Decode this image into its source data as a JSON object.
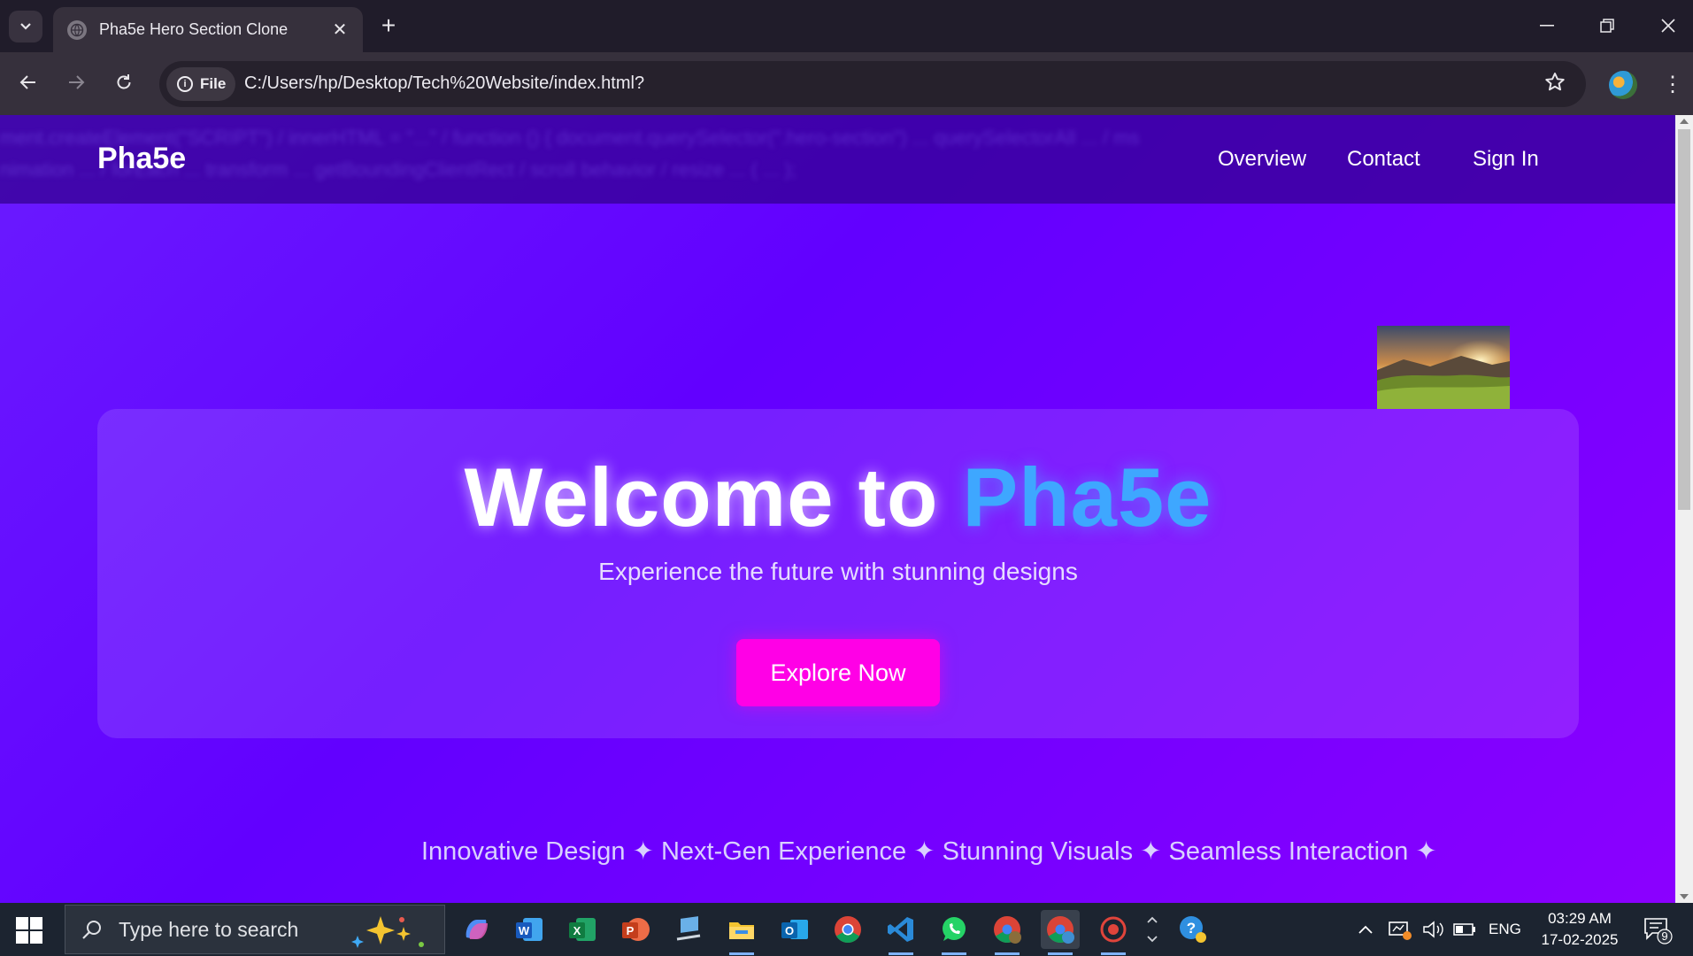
{
  "browser": {
    "tab_title": "Pha5e Hero Section Clone",
    "chip_label": "File",
    "url": "C:/Users/hp/Desktop/Tech%20Website/index.html?"
  },
  "site": {
    "brand": "Pha5e",
    "nav": [
      "Overview",
      "Contact",
      "Sign In"
    ],
    "blurred_background_text": [
      "ment.createElement(\"SCRIPT\") / innerHTML = \"...\" / function () { document.querySelector(\".hero-section\") ... querySelectorAll ... / ms",
      "nimation ... / forEach ... transform ... getBoundingClientRect / scroll behavior / resize ... ( ... );"
    ],
    "hero": {
      "title_prefix": "Welcome to ",
      "title_accent": "Pha5e",
      "subtitle": "Experience the future with stunning designs",
      "cta": "Explore Now"
    },
    "marquee": "Innovative Design ✦ Next-Gen Experience ✦ Stunning Visuals ✦ Seamless Interaction ✦"
  },
  "taskbar": {
    "search_placeholder": "Type here to search",
    "language": "ENG",
    "time": "03:29 AM",
    "date": "17-02-2025",
    "notification_count": "9"
  },
  "colors": {
    "page_gradient_start": "#6a1bff",
    "page_gradient_end": "#8b00ff",
    "accent_text": "#3ea7ff",
    "cta_background": "#ff00e6"
  }
}
